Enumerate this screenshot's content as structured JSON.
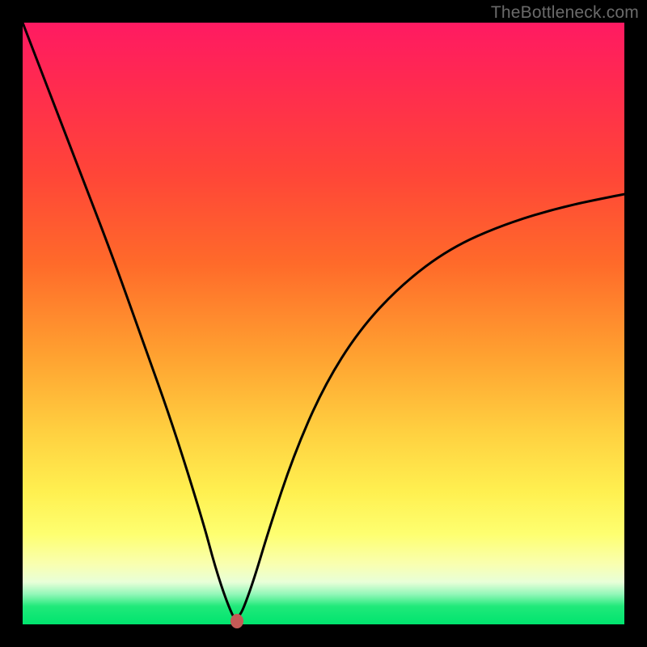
{
  "watermark": "TheBottleneck.com",
  "colors": {
    "curve": "#000000",
    "marker": "#c45a56",
    "gradient_top": "#ff1a62",
    "gradient_bottom": "#00e46e",
    "frame": "#000000"
  },
  "chart_data": {
    "type": "line",
    "title": "",
    "xlabel": "",
    "ylabel": "",
    "xlim": [
      0,
      1
    ],
    "ylim": [
      0,
      1
    ],
    "annotations": [
      "TheBottleneck.com"
    ],
    "marker": {
      "x": 0.356,
      "y": 0.0
    },
    "series": [
      {
        "name": "bottleneck-curve",
        "x": [
          0.0,
          0.05,
          0.1,
          0.15,
          0.2,
          0.25,
          0.3,
          0.32,
          0.34,
          0.356,
          0.38,
          0.41,
          0.45,
          0.5,
          0.56,
          0.63,
          0.71,
          0.8,
          0.9,
          1.0
        ],
        "y": [
          1.0,
          0.87,
          0.74,
          0.61,
          0.47,
          0.33,
          0.17,
          0.095,
          0.035,
          0.0,
          0.06,
          0.16,
          0.28,
          0.395,
          0.49,
          0.565,
          0.625,
          0.665,
          0.695,
          0.715
        ]
      }
    ]
  }
}
